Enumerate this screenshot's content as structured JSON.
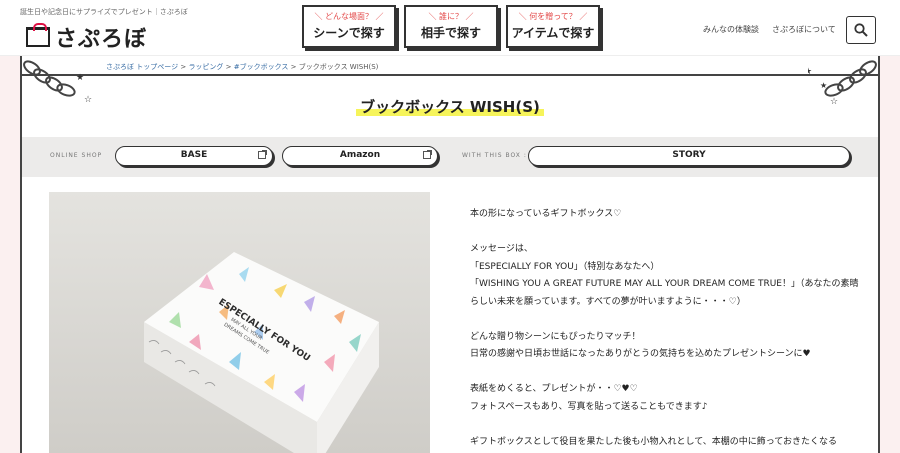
{
  "header": {
    "tagline": "誕生日や記念日にサプライズでプレゼント｜さぷろぼ",
    "logo_text": "さぷろぼ",
    "nav": [
      {
        "sub": "＼ どんな場面？ ／",
        "label": "シーンで探す"
      },
      {
        "sub": "＼ 誰に？ ／",
        "label": "相手で探す"
      },
      {
        "sub": "＼ 何を贈って？ ／",
        "label": "アイテムで探す"
      }
    ],
    "links": [
      "みんなの体験談",
      "さぷろぼについて"
    ]
  },
  "breadcrumb": {
    "items": [
      "さぷろぼ トップページ",
      "ラッピング",
      "#ブックボックス"
    ],
    "separator": ">",
    "current": "ブックボックス WISH(S)"
  },
  "page": {
    "title": "ブックボックス WISH(S)"
  },
  "shop": {
    "online_label": "ONLINE SHOP",
    "with_label": "WITH THIS BOX",
    "base_label": "BASE",
    "amazon_label": "Amazon",
    "story_label": "STORY"
  },
  "description": {
    "paragraphs": [
      "本の形になっているギフトボックス♡",
      "メッセージは、\n「ESPECIALLY FOR YOU」（特別なあなたへ）\n「WISHING YOU A GREAT FUTURE MAY ALL YOUR DREAM COME TRUE！」（あなたの素晴らしい未来を願っています。すべての夢が叶いますように・・・♡）",
      "どんな贈り物シーンにもぴったりマッチ！\n日常の感謝や日頃お世話になったありがとうの気持ちを込めたプレゼントシーンに♥",
      "表紙をめくると、プレゼントが・・♡♥♡\nフォトスペースもあり、写真を貼って送ることもできます♪",
      "ギフトボックスとして役目を果たした後も小物入れとして、本棚の中に飾っておきたくなる"
    ]
  },
  "colors": {
    "accent_red": "#e34848",
    "highlight_yellow": "#f6f45a",
    "page_bg": "#fbf0f0"
  }
}
